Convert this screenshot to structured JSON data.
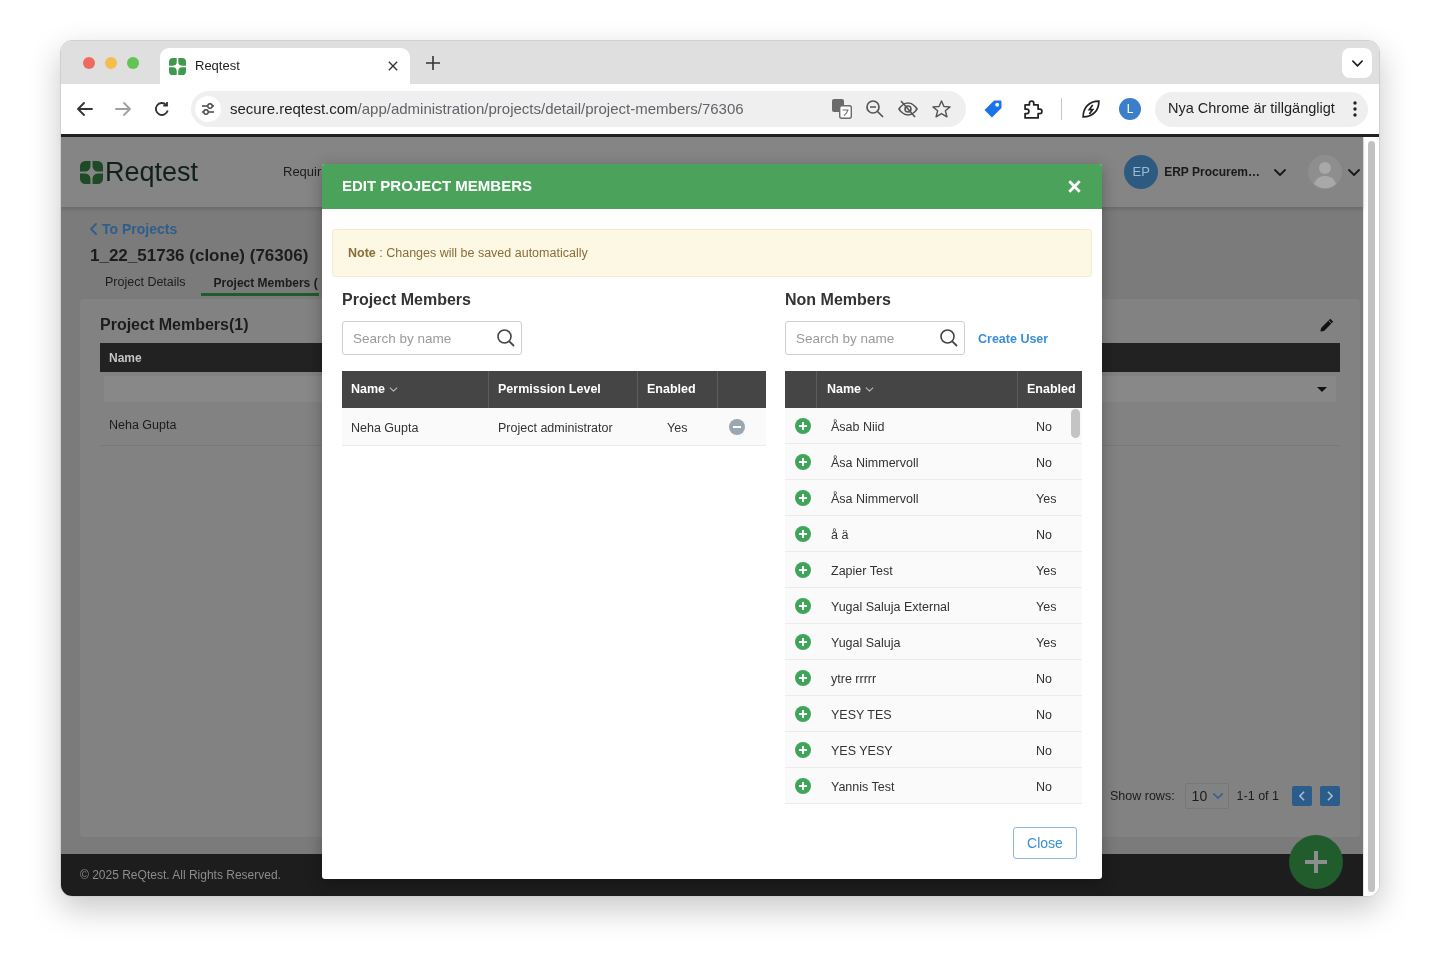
{
  "browser": {
    "tab": {
      "title": "Reqtest"
    },
    "address": {
      "host": "secure.reqtest.com",
      "path": "/app/administration/projects/detail/project-members/76306"
    },
    "profile": {
      "initial": "L"
    },
    "update_chip": "Nya Chrome är tillgängligt"
  },
  "app": {
    "logo": "Reqtest",
    "nav": [
      "Requir"
    ],
    "project_chip": {
      "initials": "EP",
      "name": "ERP Procurem…"
    },
    "back_link": "To Projects",
    "project_title": "1_22_51736 (clone) (76306)",
    "tabs": [
      {
        "label": "Project Details",
        "selected": false
      },
      {
        "label": "Project Members (",
        "selected": true
      }
    ],
    "card": {
      "title": "Project Members(1)",
      "columns": [
        "Name"
      ],
      "rows": [
        {
          "name": "Neha Gupta"
        }
      ],
      "pagination": {
        "label": "Show rows:",
        "page_size": "10",
        "range": "1-1 of 1"
      }
    },
    "footer": "© 2025 ReQtest. All Rights Reserved."
  },
  "modal": {
    "title": "EDIT PROJECT MEMBERS",
    "note": "**Note** : Changes will be saved automatically",
    "members": {
      "heading": "Project Members",
      "search": {
        "placeholder": "Search by name"
      },
      "columns": [
        {
          "label": "Name",
          "sorted": true
        },
        {
          "label": "Permission Level",
          "sorted": false
        },
        {
          "label": "Enabled",
          "sorted": false
        }
      ],
      "rows": [
        {
          "name": "Neha Gupta",
          "permission": "Project administrator",
          "enabled": "Yes"
        }
      ]
    },
    "non_members": {
      "heading": "Non Members",
      "search": {
        "placeholder": "Search by name"
      },
      "create_link": "Create User",
      "columns": [
        {
          "label": "Name",
          "sorted": true
        },
        {
          "label": "Enabled",
          "sorted": false
        }
      ],
      "rows": [
        {
          "name": "Åsab Niid",
          "enabled": "No"
        },
        {
          "name": "Åsa Nimmervoll",
          "enabled": "No"
        },
        {
          "name": "Åsa Nimmervoll",
          "enabled": "Yes"
        },
        {
          "name": "å ä",
          "enabled": "No"
        },
        {
          "name": "Zapier Test",
          "enabled": "Yes"
        },
        {
          "name": "Yugal Saluja External",
          "enabled": "Yes"
        },
        {
          "name": "Yugal Saluja",
          "enabled": "Yes"
        },
        {
          "name": "ytre rrrrr",
          "enabled": "No"
        },
        {
          "name": "YESY TES",
          "enabled": "No"
        },
        {
          "name": "YES YESY",
          "enabled": "No"
        },
        {
          "name": "Yannis Test",
          "enabled": "No"
        }
      ]
    },
    "close_button": "Close"
  }
}
